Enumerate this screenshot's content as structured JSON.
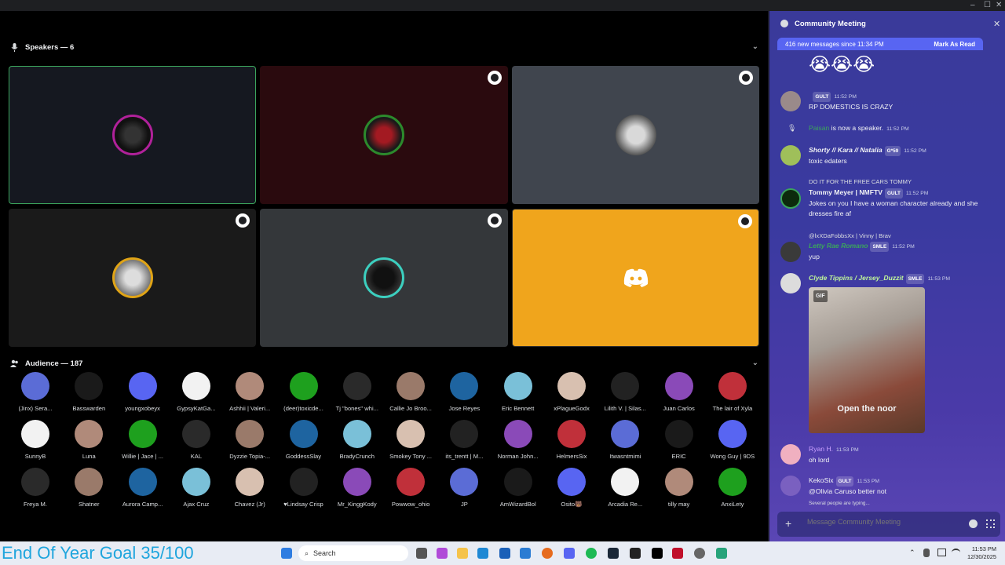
{
  "window": {
    "min": "–",
    "max": "☐",
    "close": "✕"
  },
  "speakers": {
    "title": "Speakers — 6",
    "chevron": "⌄"
  },
  "audience": {
    "title": "Audience — 187",
    "chevron": "⌄",
    "rows": [
      [
        "(Jinx) Sera...",
        "Basswarden",
        "youngxobeyx",
        "GypsyKatGa...",
        "Ashhii | Valeri...",
        "(deer)toxicde...",
        "Tj \"bones\" whi...",
        "Callie Jo Broo...",
        "Jose Reyes",
        "Eric Bennett",
        "xPlagueGodx",
        "Lilith V. | Silas...",
        "Juan Carlos",
        "The lair of Xyla"
      ],
      [
        "SunnyB",
        "Luna",
        "Willie | Jace | ...",
        "KAL",
        "Dyzzie Topia-...",
        "GoddessSlay",
        "BradyCrunch",
        "Smokey Tony ...",
        "its_trentt | M...",
        "Norman John...",
        "HelmersSix",
        "Itwasntmimi",
        "ERIC",
        "Wong Guy | 9DS"
      ],
      [
        "Freya M.",
        "Shatner",
        "Aurora Camp...",
        "Ajax Cruz",
        "Chavez (Jr)",
        "♥Lindsay Crisp",
        "Mr_KinggKody",
        "Powwow_ohio",
        "JP",
        "AmWizardBol",
        "Osito🐻",
        "Arcadia Re...",
        "tilly may",
        "AnxiLety"
      ]
    ]
  },
  "chat": {
    "title": "Community Meeting",
    "close": "✕",
    "new_messages": "416 new messages since 11:34 PM",
    "mark_read": "Mark As Read",
    "emoji_row": "😭😭😭",
    "messages": [
      {
        "who": "",
        "tag": "GULT",
        "ts": "11:52 PM",
        "text": "RP DOMESTICS IS CRAZY"
      },
      {
        "who": "Paisan",
        "text": "is now a speaker.",
        "ts": "11:52 PM"
      },
      {
        "who": "Shorty // Kara // Natalia",
        "tag": "G*59",
        "ts": "11:52 PM",
        "text": "toxic edaters"
      },
      {
        "reply": "DO IT FOR THE FREE CARS TOMMY",
        "who": "Tommy Meyer | NMFTV",
        "tag": "GULT",
        "ts": "11:52 PM",
        "text": "Jokes on you I have a woman character already and she dresses fire af"
      },
      {
        "reply": "@lxXDaFobbsXx | Vinny | Brav",
        "who": "Letty Rae Romano",
        "tag": "SMLE",
        "ts": "11:52 PM",
        "text": "yup"
      },
      {
        "who": "Clyde Tippins / Jersey_Duzzit",
        "tag": "SMLE",
        "ts": "11:53 PM",
        "gif": "GIF",
        "caption": "Open the noor"
      },
      {
        "who": "Ryan H.",
        "ts": "11:53 PM",
        "text": "oh lord"
      },
      {
        "who": "KekoSix",
        "tag": "GULT",
        "ts": "11:53 PM",
        "text": "@Olivia Caruso better not"
      }
    ],
    "typing": "Several people are typing...",
    "placeholder": "Message Community Meeting"
  },
  "taskbar": {
    "goal": "End Of Year Goal 35/100",
    "search": "Search",
    "time": "11:53 PM",
    "date": "12/30/2025"
  },
  "colors": {
    "chat_bg": "#3a3aa0",
    "accent": "#5865f2",
    "active_speaker": "#3ba55c",
    "highlight": "#f0a51c"
  }
}
